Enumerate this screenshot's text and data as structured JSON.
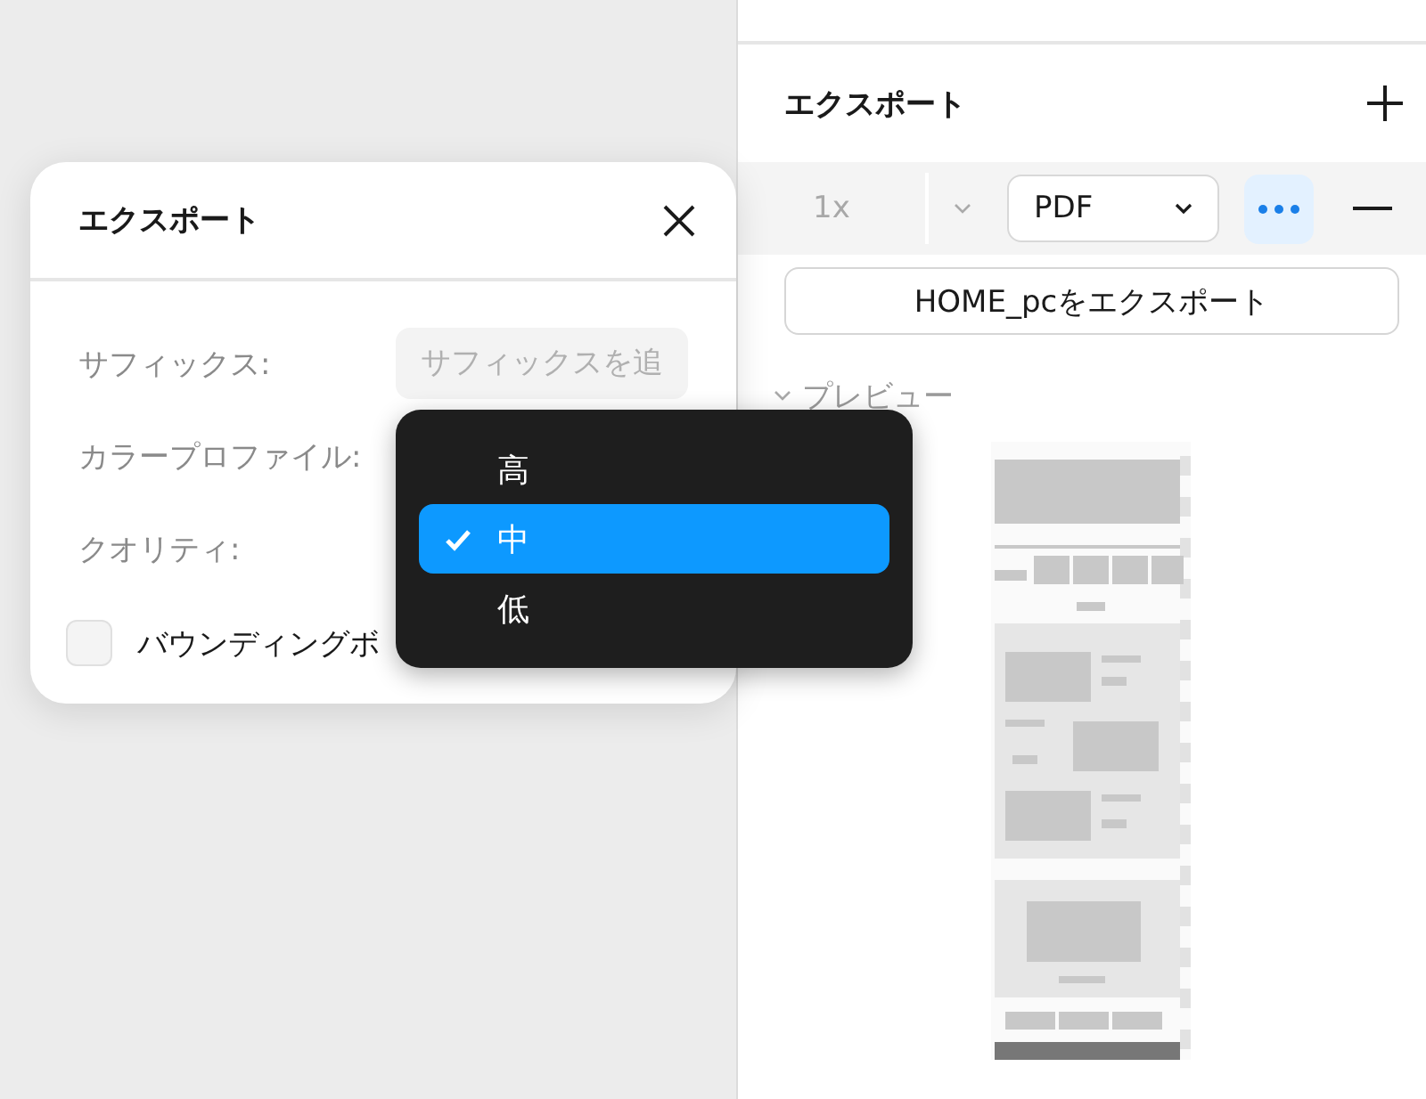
{
  "panel": {
    "title": "エクスポート",
    "scale": "1x",
    "format": "PDF",
    "export_button": "HOME_pcをエクスポート",
    "preview_label": "プレビュー"
  },
  "dialog": {
    "title": "エクスポート",
    "fields": [
      {
        "label": "サフィックス:",
        "placeholder": "サフィックスを追"
      },
      {
        "label": "カラープロファイル:"
      },
      {
        "label": "クオリティ:"
      }
    ],
    "checkbox": {
      "label": "バウンディングボ",
      "checked": false
    }
  },
  "menu": {
    "items": [
      {
        "label": "高",
        "selected": false
      },
      {
        "label": "中",
        "selected": true
      },
      {
        "label": "低",
        "selected": false
      }
    ]
  }
}
